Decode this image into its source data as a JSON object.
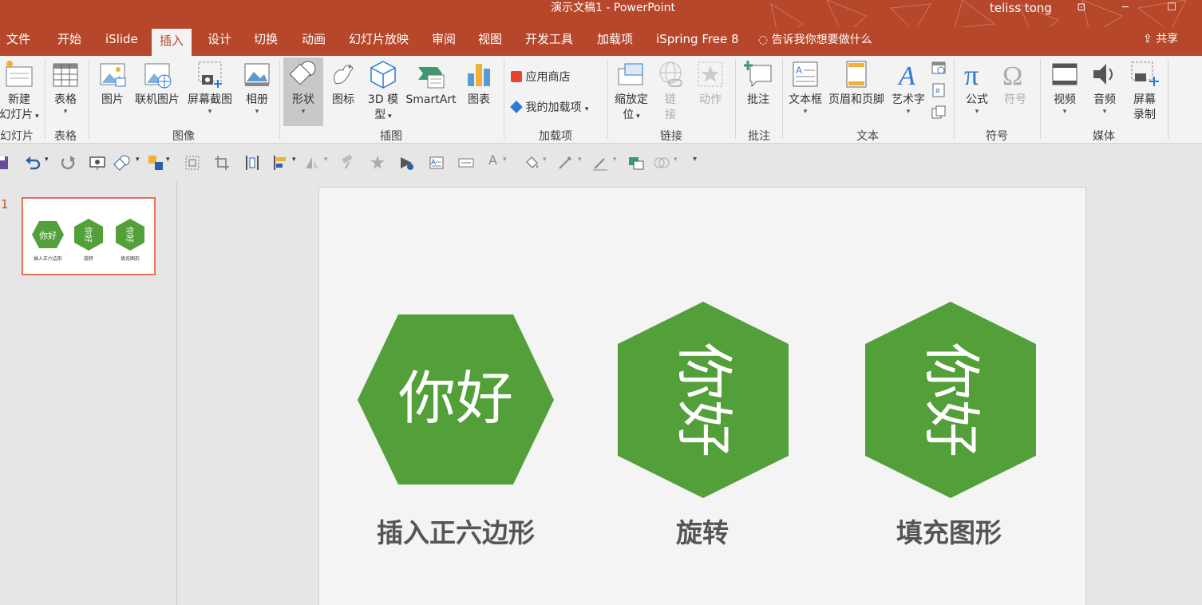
{
  "window": {
    "title": "演示文稿1  -  PowerPoint",
    "user": "teliss tong"
  },
  "tabs": [
    {
      "label": "文件"
    },
    {
      "label": "开始"
    },
    {
      "label": "iSlide"
    },
    {
      "label": "插入"
    },
    {
      "label": "设计"
    },
    {
      "label": "切换"
    },
    {
      "label": "动画"
    },
    {
      "label": "幻灯片放映"
    },
    {
      "label": "审阅"
    },
    {
      "label": "视图"
    },
    {
      "label": "开发工具"
    },
    {
      "label": "加载项"
    },
    {
      "label": "iSpring Free 8"
    }
  ],
  "active_tab": "插入",
  "tell_me": "告诉我你想要做什么",
  "share": "共享",
  "ribbon": {
    "new_slide_line1": "新建",
    "new_slide_line2": "幻灯片",
    "table": "表格",
    "picture": "图片",
    "online_picture": "联机图片",
    "screenshot": "屏幕截图",
    "album": "相册",
    "shapes": "形状",
    "icons": "图标",
    "model3d_line1": "3D 模",
    "model3d_line2": "型",
    "smartart": "SmartArt",
    "chart": "图表",
    "store": "应用商店",
    "my_addins": "我的加载项",
    "zoom_line1": "缩放定",
    "zoom_line2": "位",
    "link_line1": "链",
    "link_line2": "接",
    "action": "动作",
    "comment": "批注",
    "textbox": "文本框",
    "header_footer": "页眉和页脚",
    "wordart": "艺术字",
    "equation": "公式",
    "symbol": "符号",
    "video": "视频",
    "audio": "音频",
    "screen_rec_line1": "屏幕",
    "screen_rec_line2": "录制",
    "groups": {
      "slides": "幻灯片",
      "tables": "表格",
      "images": "图像",
      "illustrations": "插图",
      "addins": "加载项",
      "links": "链接",
      "comments": "批注",
      "text": "文本",
      "symbols": "符号",
      "media": "媒体"
    }
  },
  "thumbnail": {
    "number": "1",
    "captions": [
      "插入正六边形",
      "旋转",
      "填充图形"
    ]
  },
  "slide": {
    "hex_text": "你好",
    "captions": [
      "插入正六边形",
      "旋转",
      "填充图形"
    ],
    "hex_color": "#539f3a"
  },
  "colors": {
    "accent": "#b7472a",
    "thumb_border": "#e8715a"
  }
}
